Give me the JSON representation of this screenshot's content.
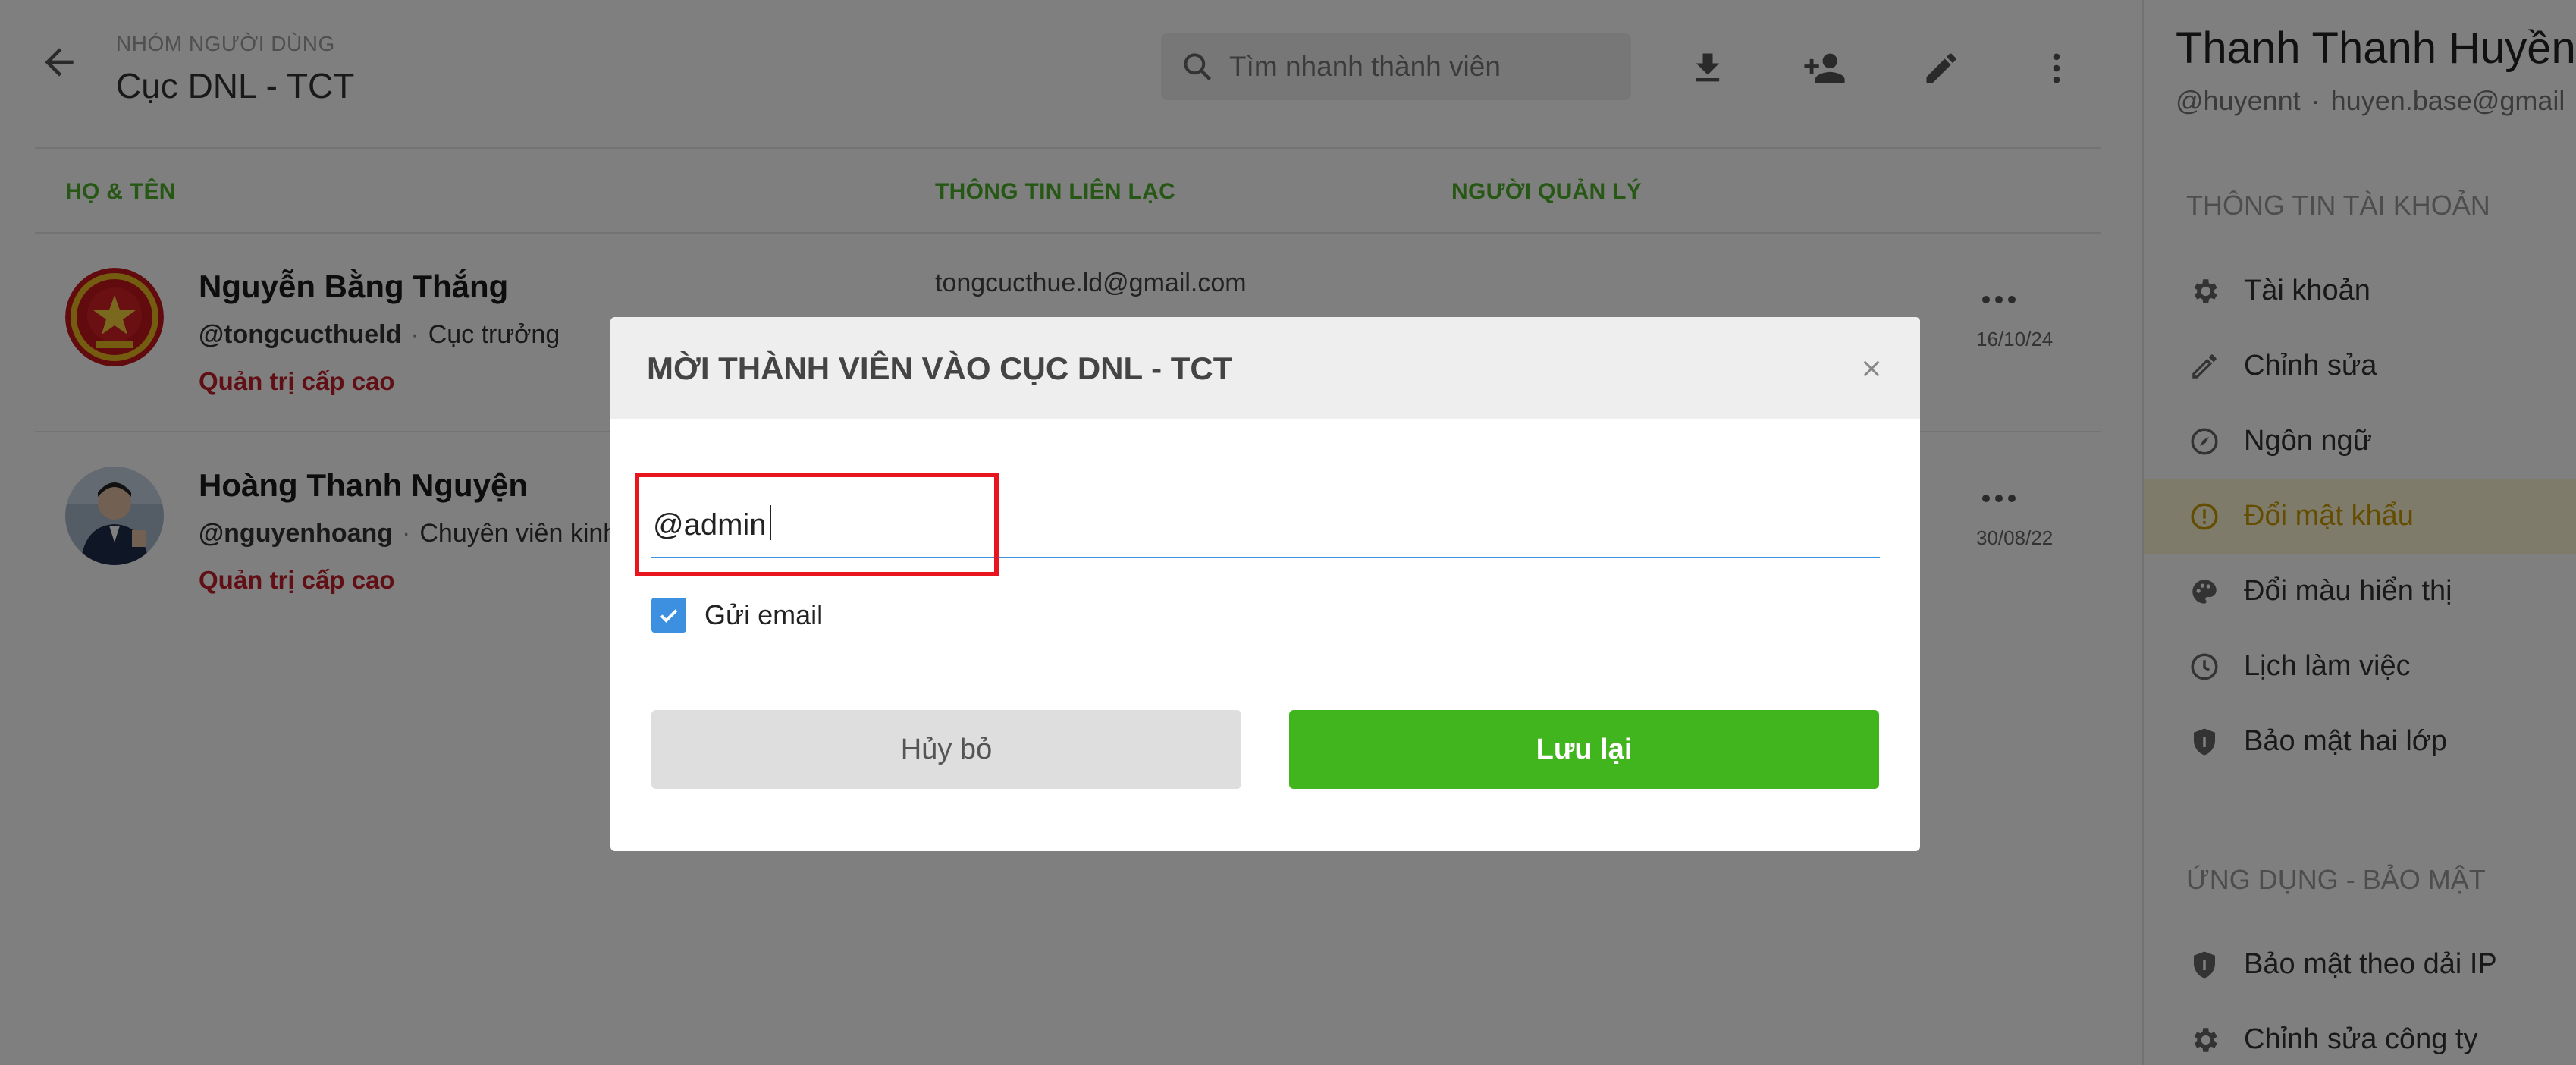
{
  "header": {
    "crumb": "NHÓM NGƯỜI DÙNG",
    "title": "Cục DNL - TCT",
    "search_placeholder": "Tìm nhanh thành viên"
  },
  "table": {
    "columns": [
      "HỌ & TÊN",
      "THÔNG TIN LIÊN LẠC",
      "NGƯỜI QUẢN LÝ"
    ],
    "members": [
      {
        "name": "Nguyễn Bằng Thắng",
        "handle": "@tongcucthueld",
        "position": "Cục trưởng",
        "role": "Quản trị cấp cao",
        "email": "tongcucthue.ld@gmail.com",
        "date": "16/10/24"
      },
      {
        "name": "Hoàng Thanh Nguyện",
        "handle": "@nguyenhoang",
        "position": "Chuyên viên kinh",
        "role": "Quản trị cấp cao",
        "email": "",
        "date": "30/08/22"
      }
    ]
  },
  "profile": {
    "name": "Thanh Thanh Huyền",
    "handle": "@huyennt",
    "email": "huyen.base@gmail",
    "section_account": "THÔNG TIN TÀI KHOẢN",
    "section_apps": "ỨNG DỤNG - BẢO MẬT",
    "account_items": [
      {
        "label": "Tài khoản",
        "icon": "gear-icon"
      },
      {
        "label": "Chỉnh sửa",
        "icon": "pencil-icon"
      },
      {
        "label": "Ngôn ngữ",
        "icon": "compass-icon"
      },
      {
        "label": "Đổi mật khẩu",
        "icon": "alert-circle-icon"
      },
      {
        "label": "Đổi màu hiển thị",
        "icon": "palette-icon"
      },
      {
        "label": "Lịch làm việc",
        "icon": "clock-icon"
      },
      {
        "label": "Bảo mật hai lớp",
        "icon": "shield-icon"
      }
    ],
    "app_items": [
      {
        "label": "Bảo mật theo dải IP",
        "icon": "shield-icon"
      },
      {
        "label": "Chỉnh sửa công ty",
        "icon": "gear-icon"
      }
    ]
  },
  "modal": {
    "title": "MỜI THÀNH VIÊN VÀO CỤC DNL - TCT",
    "input_value": "@admin",
    "send_email_label": "Gửi email",
    "send_email_checked": true,
    "cancel_label": "Hủy bỏ",
    "save_label": "Lưu lại"
  },
  "colors": {
    "accent_green": "#41b51d",
    "column_header_green": "#4caf2a",
    "role_red": "#c0212b",
    "checkbox_blue": "#3d8fe0",
    "highlight_red": "#e8151f",
    "active_item_bg": "#fdf6d6"
  }
}
